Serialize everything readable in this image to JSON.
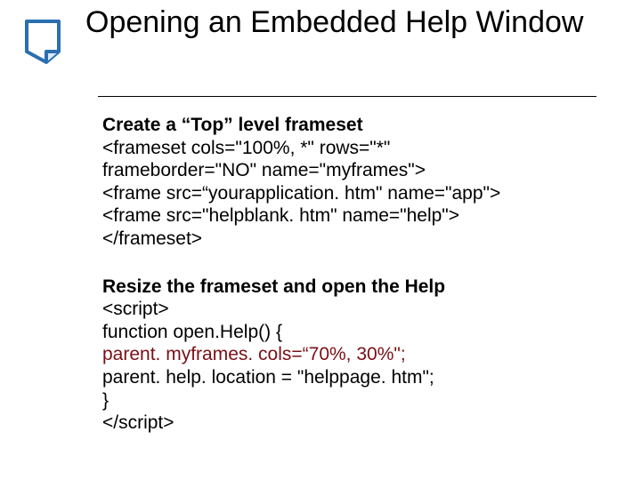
{
  "title": "Opening an Embedded Help Window",
  "section1": {
    "heading": "Create a “Top” level frameset",
    "line1": "<frameset cols=\"100%, *\" rows=\"*\"",
    "line2": "frameborder=\"NO\" name=\"myframes\">",
    "line3": "<frame src=“yourapplication. htm\" name=\"app\">",
    "line4": "<frame src=\"helpblank. htm\" name=\"help\">",
    "line5": "</frameset>"
  },
  "section2": {
    "heading": "Resize the frameset and open the Help",
    "line1": "<script>",
    "line2": "function open.Help() {",
    "line3": "parent. myframes. cols=“70%, 30%\";",
    "line4": "parent. help. location = \"helppage. htm\";",
    "line5": "}",
    "line6": "</script>"
  }
}
